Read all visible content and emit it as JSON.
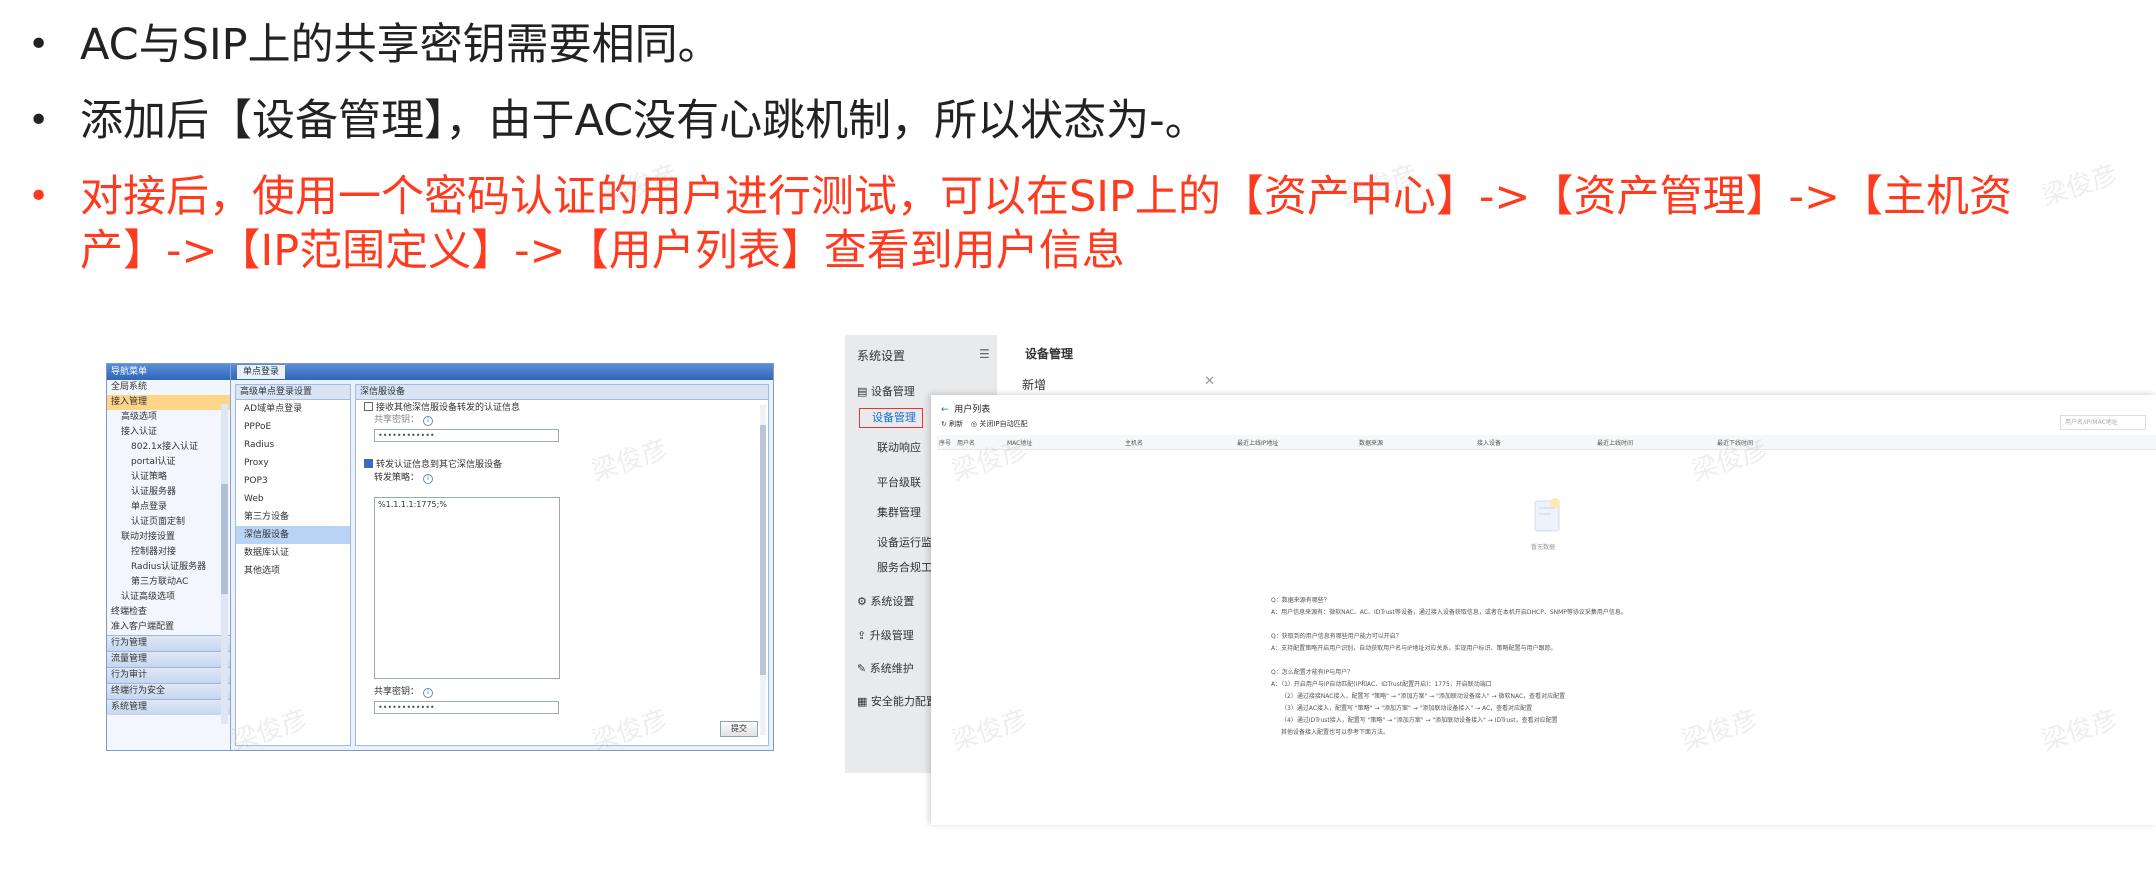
{
  "bullets": [
    {
      "text": "AC与SIP上的共享密钥需要相同。",
      "color": "#222222"
    },
    {
      "text": "添加后【设备管理】，由于AC没有心跳机制，所以状态为-。",
      "color": "#222222"
    },
    {
      "text": "对接后，使用一个密码认证的用户进行测试，可以在SIP上的【资产中心】->【资产管理】->【主机资产】->【IP范围定义】->【用户列表】查看到用户信息",
      "color": "#ff3b1f"
    }
  ],
  "watermark": "梁俊彦",
  "ac": {
    "nav_header": "导航菜单",
    "nav_items": [
      "全局系统",
      "接入管理",
      "高级选项",
      "接入认证",
      "802.1x接入认证",
      "portal认证",
      "认证策略",
      "认证服务器",
      "单点登录",
      "认证页面定制",
      "联动对接设置",
      "控制器对接",
      "Radius认证服务器",
      "第三方联动AC",
      "认证高级选项",
      "终端检查",
      "准入客户端配置"
    ],
    "nav_groups": [
      "行为管理",
      "流量管理",
      "行为审计",
      "终端行为安全",
      "系统管理"
    ],
    "tab": "单点登录",
    "mid_header": "高级单点登录设置",
    "mid_items": [
      "AD域单点登录",
      "PPPoE",
      "Radius",
      "Proxy",
      "POP3",
      "Web",
      "第三方设备",
      "深信服设备",
      "数据库认证",
      "其他选项"
    ],
    "form_header": "深信服设备",
    "opt1_label": "接收其他深信服设备转发的认证信息",
    "shared_key_label": "共享密钥：",
    "masked_value": "••••••••••••",
    "opt2_label": "转发认证信息到其它深信服设备",
    "forward_list_label": "转发策略：",
    "forward_list_value": "%1.1.1.1:1775;%",
    "shared_key_label2": "共享密钥：",
    "submit": "提交"
  },
  "sip": {
    "sidebar_title": "系统设置",
    "sidebar_items": [
      "设备管理",
      "设备管理",
      "联动响应",
      "平台级联",
      "集群管理",
      "设备运行监测",
      "服务合规工具",
      "系统设置",
      "升级管理",
      "系统维护",
      "安全能力配置"
    ],
    "bg_title": "设备管理",
    "dialog_title": "新增",
    "panel_title": "用户列表",
    "toolbar": [
      "刷新",
      "关闭IP自动匹配"
    ],
    "search_placeholder": "用户名/IP/MAC地址",
    "columns": [
      "序号",
      "用户名",
      "MAC地址",
      "主机名",
      "最近上线IP地址",
      "数据来源",
      "接入设备",
      "最近上线时间",
      "最近下线时间"
    ],
    "empty_text": "暂无数据",
    "faq": [
      {
        "q": "Q：数据来源有哪些？",
        "a": "A：用户信息来源有：微软NAC、AC、IDTrust等设备，通过接入设备获取信息，或者在本机开启DHCP、SNMP等协议采集用户信息。"
      },
      {
        "q": "Q：获取到的用户信息有哪些用户能力可以开启？",
        "a": "A：支持配置策略开启用户识别，自动获取用户名与IP地址对应关系，实现用户标识、策略配置与用户跟踪。"
      },
      {
        "q": "Q：怎么配置才能有IP与用户？",
        "a": "A：（1）开启用户与IP自动匹配(IP和AC、IDTrust配置开启)：1775，开启联动端口"
      },
      {
        "q": "",
        "a": "（2）通过接接NAC接入，配置写 \"策略\" → \"添加方案\" → \"添加联动设备接入\" → 微软NAC，查看对应配置"
      },
      {
        "q": "",
        "a": "（3）通过AC接入，配置写 \"策略\" → \"添加方案\" → \"添加联动设备接入\" → AC，查看对应配置"
      },
      {
        "q": "",
        "a": "（4）通过IDTrust接入，配置写 \"策略\" → \"添加方案\" → \"添加联动设备接入\" → IDTrust，查看对应配置"
      },
      {
        "q": "",
        "a": "其他设备接入配置也可以参考下面方法。"
      }
    ]
  }
}
